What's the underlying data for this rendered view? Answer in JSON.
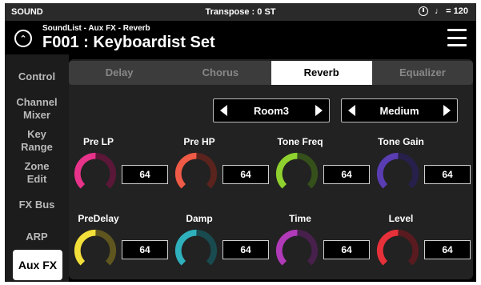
{
  "statusbar": {
    "mode": "SOUND",
    "transpose": "Transpose : 0 ST",
    "tempo": "♩ = 120",
    "metronome_icon": "metronome-icon"
  },
  "header": {
    "path": "SoundList - Aux FX - Reverb",
    "title": "F001 : Keyboardist Set"
  },
  "sidebar": {
    "items": [
      {
        "label": "Control"
      },
      {
        "label": "Channel\nMixer"
      },
      {
        "label": "Key\nRange"
      },
      {
        "label": "Zone\nEdit"
      },
      {
        "label": "FX Bus"
      },
      {
        "label": "ARP"
      },
      {
        "label": "Aux FX",
        "active": true
      }
    ]
  },
  "tabs": [
    {
      "label": "Delay"
    },
    {
      "label": "Chorus"
    },
    {
      "label": "Reverb",
      "active": true
    },
    {
      "label": "Equalizer"
    }
  ],
  "selectors": {
    "type": "Room3",
    "size": "Medium"
  },
  "params": [
    {
      "label": "Pre LP",
      "value": "64",
      "color": "#e8338a",
      "dim": "#5a1738"
    },
    {
      "label": "Pre HP",
      "value": "64",
      "color": "#ef5b46",
      "dim": "#5b231d"
    },
    {
      "label": "Tone Freq",
      "value": "64",
      "color": "#8fd12e",
      "dim": "#35501a"
    },
    {
      "label": "Tone Gain",
      "value": "64",
      "color": "#5a3db3",
      "dim": "#27204b"
    },
    {
      "label": "PreDelay",
      "value": "64",
      "color": "#f3df3a",
      "dim": "#5e561e"
    },
    {
      "label": "Damp",
      "value": "64",
      "color": "#2fb1bd",
      "dim": "#194a4f"
    },
    {
      "label": "Time",
      "value": "64",
      "color": "#b13ab8",
      "dim": "#47204b"
    },
    {
      "label": "Level",
      "value": "64",
      "color": "#e6313a",
      "dim": "#591b1f"
    }
  ]
}
